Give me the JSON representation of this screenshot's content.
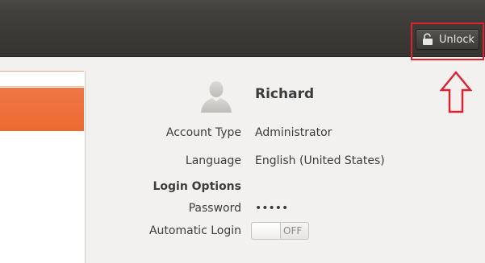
{
  "header": {
    "unlock_label": "Unlock",
    "unlock_icon": "lock-icon"
  },
  "user": {
    "name": "Richard",
    "avatar_icon": "user-silhouette-icon"
  },
  "details": {
    "account_type_label": "Account Type",
    "account_type_value": "Administrator",
    "language_label": "Language",
    "language_value": "English (United States)",
    "login_options_title": "Login Options",
    "password_label": "Password",
    "password_value": "•••••",
    "automatic_login_label": "Automatic Login",
    "automatic_login_state": "OFF"
  },
  "colors": {
    "selection_orange": "#ec6a30",
    "highlight_red": "#e0202c",
    "titlebar": "#3f3e3a"
  }
}
